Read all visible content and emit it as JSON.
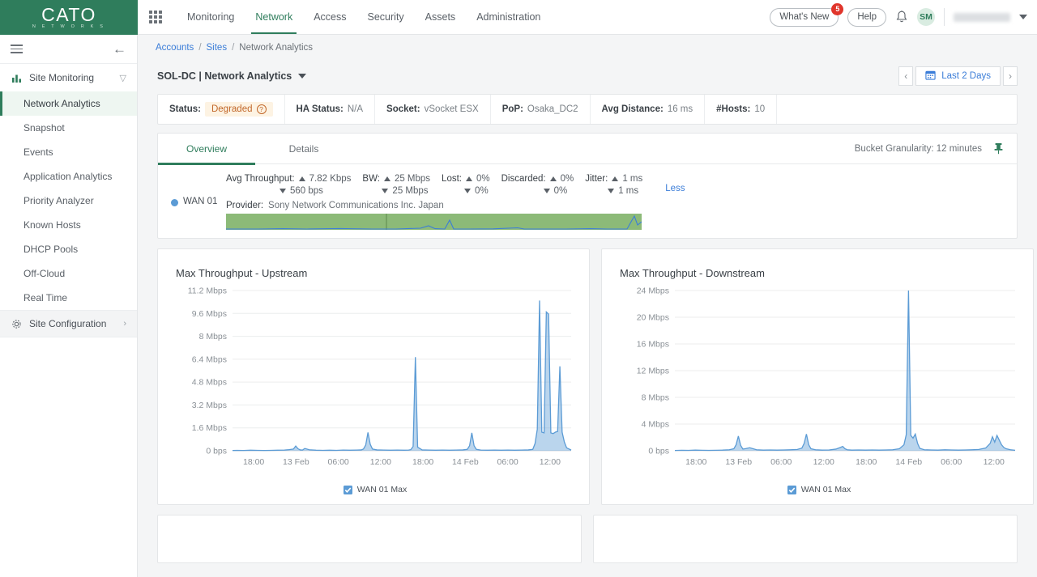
{
  "brand": {
    "name": "CATO",
    "sub": "N E T W O R K S",
    "color": "#2f7d5c"
  },
  "topnav": {
    "apps_icon": "grid-apps-icon",
    "items": [
      {
        "label": "Monitoring",
        "active": false
      },
      {
        "label": "Network",
        "active": true
      },
      {
        "label": "Access",
        "active": false
      },
      {
        "label": "Security",
        "active": false
      },
      {
        "label": "Assets",
        "active": false
      },
      {
        "label": "Administration",
        "active": false
      }
    ],
    "whats_new": "What's New",
    "whats_new_badge": "5",
    "help": "Help",
    "notifications_icon": "bell-icon",
    "avatar_initials": "SM",
    "user_name": ""
  },
  "sidebar": {
    "menu_icon": "hamburger-icon",
    "collapse_icon": "arrow-left-icon",
    "groups": [
      {
        "label": "Site Monitoring",
        "icon": "bar-chart-icon",
        "chevron": "chevron-down-icon"
      }
    ],
    "items": [
      {
        "label": "Network Analytics",
        "active": true
      },
      {
        "label": "Snapshot",
        "active": false
      },
      {
        "label": "Events",
        "active": false
      },
      {
        "label": "Application Analytics",
        "active": false
      },
      {
        "label": "Priority Analyzer",
        "active": false
      },
      {
        "label": "Known Hosts",
        "active": false
      },
      {
        "label": "DHCP Pools",
        "active": false
      },
      {
        "label": "Off-Cloud",
        "active": false
      },
      {
        "label": "Real Time",
        "active": false
      }
    ],
    "config": {
      "label": "Site Configuration",
      "icon": "gear-icon",
      "chevron": "chevron-right-icon"
    }
  },
  "breadcrumb": {
    "accounts": "Accounts",
    "sites": "Sites",
    "current": "Network Analytics",
    "sep": "/"
  },
  "header": {
    "title": "SOL-DC | Network Analytics",
    "title_caret": "caret-down-icon",
    "date_prev": "‹",
    "date_next": "›",
    "date_range": "Last 2 Days",
    "calendar_icon": "calendar-icon"
  },
  "status_strip": [
    {
      "key": "Status:",
      "value": "Degraded",
      "badge": true,
      "badge_bg": "#fdf3e3",
      "badge_fg": "#c2682a",
      "help_icon": "question-circle-icon"
    },
    {
      "key": "HA Status:",
      "value": "N/A",
      "badge": false
    },
    {
      "key": "Socket:",
      "value": "vSocket ESX",
      "badge": false
    },
    {
      "key": "PoP:",
      "value": "Osaka_DC2",
      "badge": false
    },
    {
      "key": "Avg Distance:",
      "value": "16 ms",
      "badge": false
    },
    {
      "key": "#Hosts:",
      "value": "10",
      "badge": false
    }
  ],
  "overview": {
    "tabs": [
      {
        "label": "Overview",
        "active": true
      },
      {
        "label": "Details",
        "active": false
      }
    ],
    "granularity": "Bucket Granularity: 12 minutes",
    "pin_icon": "pin-icon",
    "wan": {
      "name": "WAN 01",
      "dot_color": "#5b9bd5",
      "less_label": "Less",
      "provider_key": "Provider:",
      "provider_value": "Sony Network Communications Inc. Japan",
      "metrics": [
        {
          "key": "Avg Throughput:",
          "up": "7.82 Kbps",
          "down": "560 bps"
        },
        {
          "key": "BW:",
          "up": "25 Mbps",
          "down": "25 Mbps"
        },
        {
          "key": "Lost:",
          "up": "0%",
          "down": "0%"
        },
        {
          "key": "Discarded:",
          "up": "0%",
          "down": "0%"
        },
        {
          "key": "Jitter:",
          "up": "1 ms",
          "down": "1 ms"
        }
      ]
    }
  },
  "chart_data": [
    {
      "type": "area",
      "title": "Max Throughput - Upstream",
      "xlabel": "",
      "ylabel": "",
      "grid": true,
      "legend_position": "bottom",
      "legend": [
        "WAN 01 Max"
      ],
      "series_color": "#5b9bd5",
      "ytick_labels": [
        "0 bps",
        "1.6 Mbps",
        "3.2 Mbps",
        "4.8 Mbps",
        "6.4 Mbps",
        "8 Mbps",
        "9.6 Mbps",
        "11.2 Mbps"
      ],
      "ytick_values": [
        0,
        1.6,
        3.2,
        4.8,
        6.4,
        8.0,
        9.6,
        11.2
      ],
      "ylim": [
        0,
        11.2
      ],
      "xtick_labels": [
        "18:00",
        "13 Feb",
        "06:00",
        "12:00",
        "18:00",
        "14 Feb",
        "06:00",
        "12:00"
      ],
      "unit": "Mbps",
      "series": [
        {
          "name": "WAN 01 Max",
          "x": [
            0,
            2,
            5,
            8,
            11,
            14,
            17,
            20,
            23,
            25,
            27,
            28,
            29,
            30,
            31,
            32,
            34,
            37,
            40,
            43,
            46,
            49,
            52,
            55,
            57,
            58,
            59,
            60,
            61,
            62,
            64,
            67,
            70,
            73,
            76,
            78,
            79,
            80,
            81,
            82,
            84,
            87,
            90,
            93,
            96,
            99,
            102,
            104,
            105,
            106,
            107,
            108,
            110,
            113,
            116,
            119,
            122,
            125,
            128,
            131,
            133,
            134,
            135,
            136,
            137,
            138,
            139,
            140,
            141,
            142,
            143,
            144,
            145,
            146,
            147,
            148,
            150
          ],
          "y": [
            0.02,
            0.03,
            0.02,
            0.04,
            0.03,
            0.02,
            0.03,
            0.04,
            0.05,
            0.08,
            0.12,
            0.33,
            0.14,
            0.06,
            0.05,
            0.16,
            0.07,
            0.04,
            0.03,
            0.04,
            0.03,
            0.05,
            0.04,
            0.05,
            0.06,
            0.12,
            0.4,
            1.28,
            0.45,
            0.12,
            0.06,
            0.05,
            0.04,
            0.05,
            0.04,
            0.05,
            0.08,
            0.3,
            6.55,
            0.25,
            0.06,
            0.05,
            0.04,
            0.05,
            0.04,
            0.05,
            0.06,
            0.1,
            0.35,
            1.25,
            0.35,
            0.1,
            0.05,
            0.04,
            0.05,
            0.04,
            0.05,
            0.04,
            0.05,
            0.06,
            0.1,
            0.5,
            1.5,
            10.5,
            1.3,
            1.25,
            9.7,
            9.55,
            1.25,
            1.2,
            1.3,
            1.35,
            5.9,
            1.3,
            0.6,
            0.2,
            0.05
          ]
        }
      ]
    },
    {
      "type": "area",
      "title": "Max Throughput - Downstream",
      "xlabel": "",
      "ylabel": "",
      "grid": true,
      "legend_position": "bottom",
      "legend": [
        "WAN 01 Max"
      ],
      "series_color": "#5b9bd5",
      "ytick_labels": [
        "0 bps",
        "4 Mbps",
        "8 Mbps",
        "12 Mbps",
        "16 Mbps",
        "20 Mbps",
        "24 Mbps"
      ],
      "ytick_values": [
        0,
        4,
        8,
        12,
        16,
        20,
        24
      ],
      "ylim": [
        0,
        24
      ],
      "xtick_labels": [
        "18:00",
        "13 Feb",
        "06:00",
        "12:00",
        "18:00",
        "14 Feb",
        "06:00",
        "12:00"
      ],
      "unit": "Mbps",
      "series": [
        {
          "name": "WAN 01 Max",
          "x": [
            0,
            3,
            6,
            9,
            12,
            15,
            18,
            21,
            24,
            26,
            27,
            28,
            29,
            30,
            31,
            33,
            36,
            39,
            42,
            45,
            48,
            51,
            54,
            56,
            57,
            58,
            59,
            60,
            62,
            65,
            68,
            71,
            73,
            74,
            75,
            76,
            78,
            81,
            84,
            87,
            90,
            93,
            96,
            99,
            101,
            102,
            103,
            104,
            105,
            106,
            107,
            108,
            110,
            113,
            116,
            119,
            122,
            125,
            128,
            131,
            134,
            137,
            139,
            140,
            141,
            142,
            143,
            144,
            145,
            146,
            148,
            150
          ],
          "y": [
            0.05,
            0.08,
            0.06,
            0.1,
            0.08,
            0.06,
            0.08,
            0.1,
            0.15,
            0.3,
            0.9,
            2.2,
            0.8,
            0.25,
            0.3,
            0.45,
            0.15,
            0.1,
            0.12,
            0.1,
            0.12,
            0.15,
            0.2,
            0.4,
            1.1,
            2.5,
            0.9,
            0.3,
            0.15,
            0.1,
            0.12,
            0.25,
            0.5,
            0.65,
            0.3,
            0.15,
            0.1,
            0.12,
            0.1,
            0.12,
            0.1,
            0.12,
            0.15,
            0.3,
            0.9,
            2.4,
            24.0,
            2.3,
            1.9,
            2.5,
            1.1,
            0.35,
            0.15,
            0.12,
            0.1,
            0.15,
            0.12,
            0.1,
            0.12,
            0.15,
            0.2,
            0.4,
            1.1,
            2.1,
            1.3,
            2.3,
            1.6,
            0.9,
            0.5,
            0.3,
            0.15,
            0.08
          ]
        }
      ]
    }
  ]
}
